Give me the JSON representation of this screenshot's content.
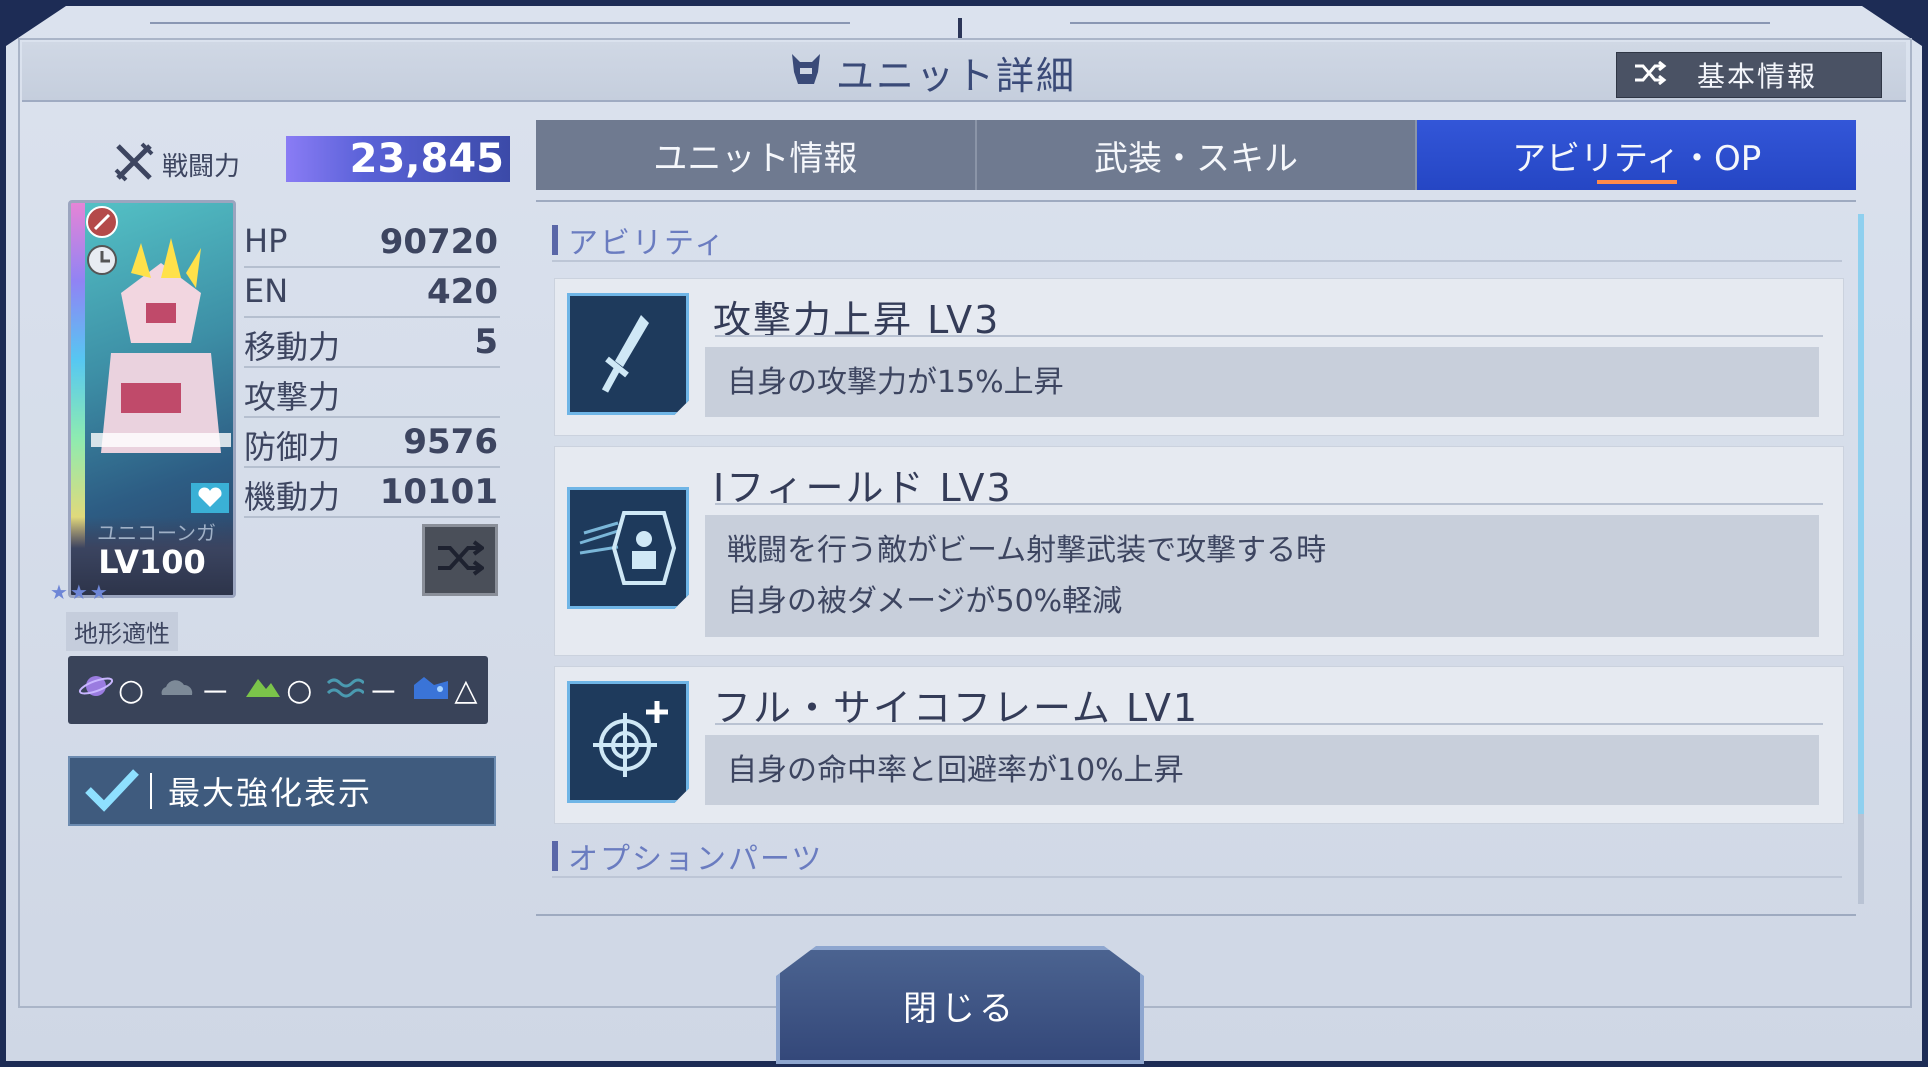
{
  "header": {
    "title": "ユニット詳細",
    "basic_info_label": "基本情報"
  },
  "unit": {
    "power_label": "戦闘力",
    "power_value": "23,845",
    "card_name": "ユニコーンガ",
    "level": "LV100",
    "stars": "★★★",
    "stats": [
      {
        "label": "HP",
        "value": "90720"
      },
      {
        "label": "EN",
        "value": "420"
      },
      {
        "label": "移動力",
        "value": "5"
      },
      {
        "label": "攻撃力",
        "value": ""
      },
      {
        "label": "防御力",
        "value": "9576"
      },
      {
        "label": "機動力",
        "value": "10101"
      }
    ],
    "terrain_label": "地形適性",
    "terrain": [
      {
        "icon": "space-planet-icon",
        "grade": "○"
      },
      {
        "icon": "air-cloud-icon",
        "grade": "－"
      },
      {
        "icon": "ground-mountain-icon",
        "grade": "○"
      },
      {
        "icon": "water-wave-icon",
        "grade": "－"
      },
      {
        "icon": "underwater-icon",
        "grade": "△"
      }
    ],
    "max_strengthen_label": "最大強化表示"
  },
  "tabs": [
    {
      "label": "ユニット情報",
      "active": false
    },
    {
      "label": "武装・スキル",
      "active": false
    },
    {
      "label": "アビリティ・OP",
      "active": true
    }
  ],
  "abilities_section": {
    "title": "アビリティ",
    "items": [
      {
        "name": "攻撃力上昇 LV3",
        "icon": "sword-icon",
        "desc": [
          "自身の攻撃力が15%上昇"
        ]
      },
      {
        "name": "Iフィールド LV3",
        "icon": "i-field-shield-icon",
        "desc": [
          "戦闘を行う敵がビーム射撃武装で攻撃する時",
          "自身の被ダメージが50%軽減"
        ]
      },
      {
        "name": "フル・サイコフレーム LV1",
        "icon": "crosshair-plus-icon",
        "desc": [
          "自身の命中率と回避率が10%上昇"
        ]
      }
    ]
  },
  "options_section": {
    "title": "オプションパーツ"
  },
  "close_label": "閉じる",
  "colors": {
    "accent_tab": "#2d4fd0",
    "panel_bg": "#d3dae6",
    "text": "#3d4560",
    "power_gradient": "#6a6ae8"
  }
}
